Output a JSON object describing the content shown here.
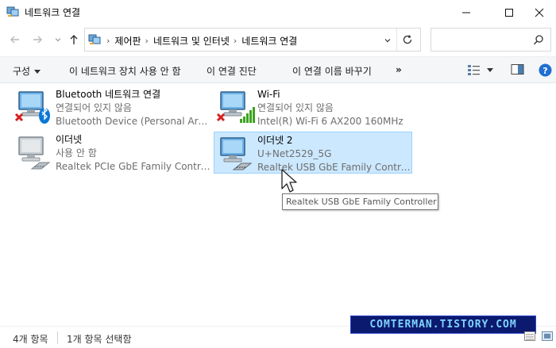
{
  "window": {
    "title": "네트워크 연결",
    "controls": {
      "minimize_icon": "minimize-icon",
      "maximize_icon": "maximize-icon",
      "close_icon": "close-icon"
    }
  },
  "address_bar": {
    "breadcrumbs": [
      "제어판",
      "네트워크 및 인터넷",
      "네트워크 연결"
    ],
    "search": {
      "placeholder": "",
      "value": ""
    }
  },
  "toolbar": {
    "organize_label": "구성",
    "disable_label": "이 네트워크 장치 사용 안 함",
    "diagnose_label": "이 연결 진단",
    "rename_label": "이 연결 이름 바꾸기",
    "more_label": "»"
  },
  "connections": [
    {
      "name": "Bluetooth 네트워크 연결",
      "status": "연결되어 있지 않음",
      "device": "Bluetooth Device (Personal Area ...",
      "icon": "bluetooth-adapter-icon",
      "error": true,
      "selected": false
    },
    {
      "name": "Wi-Fi",
      "status": "연결되어 있지 않음",
      "device": "Intel(R) Wi-Fi 6 AX200 160MHz",
      "icon": "wifi-adapter-icon",
      "error": true,
      "selected": false
    },
    {
      "name": "이더넷",
      "status": "사용 안 함",
      "device": "Realtek PCIe GbE Family Controller",
      "icon": "ethernet-adapter-icon",
      "error": false,
      "selected": false
    },
    {
      "name": "이더넷 2",
      "status": "U+Net2529_5G",
      "device": "Realtek USB GbE Family Controller",
      "icon": "ethernet-adapter-icon",
      "error": false,
      "selected": true
    }
  ],
  "tooltip": {
    "text": "Realtek USB GbE Family Controller"
  },
  "status_bar": {
    "item_count": "4개 항목",
    "selected_count": "1개 항목 선택함"
  },
  "watermark": {
    "text": "COMTERMAN.TISTORY.COM"
  },
  "colors": {
    "selection_bg": "#cce8ff",
    "selection_border": "#99d1ff",
    "error_red": "#d81e1e",
    "bluetooth_blue": "#0a78d7",
    "wifi_green": "#3aa31f",
    "help_blue": "#1f6fd1"
  }
}
